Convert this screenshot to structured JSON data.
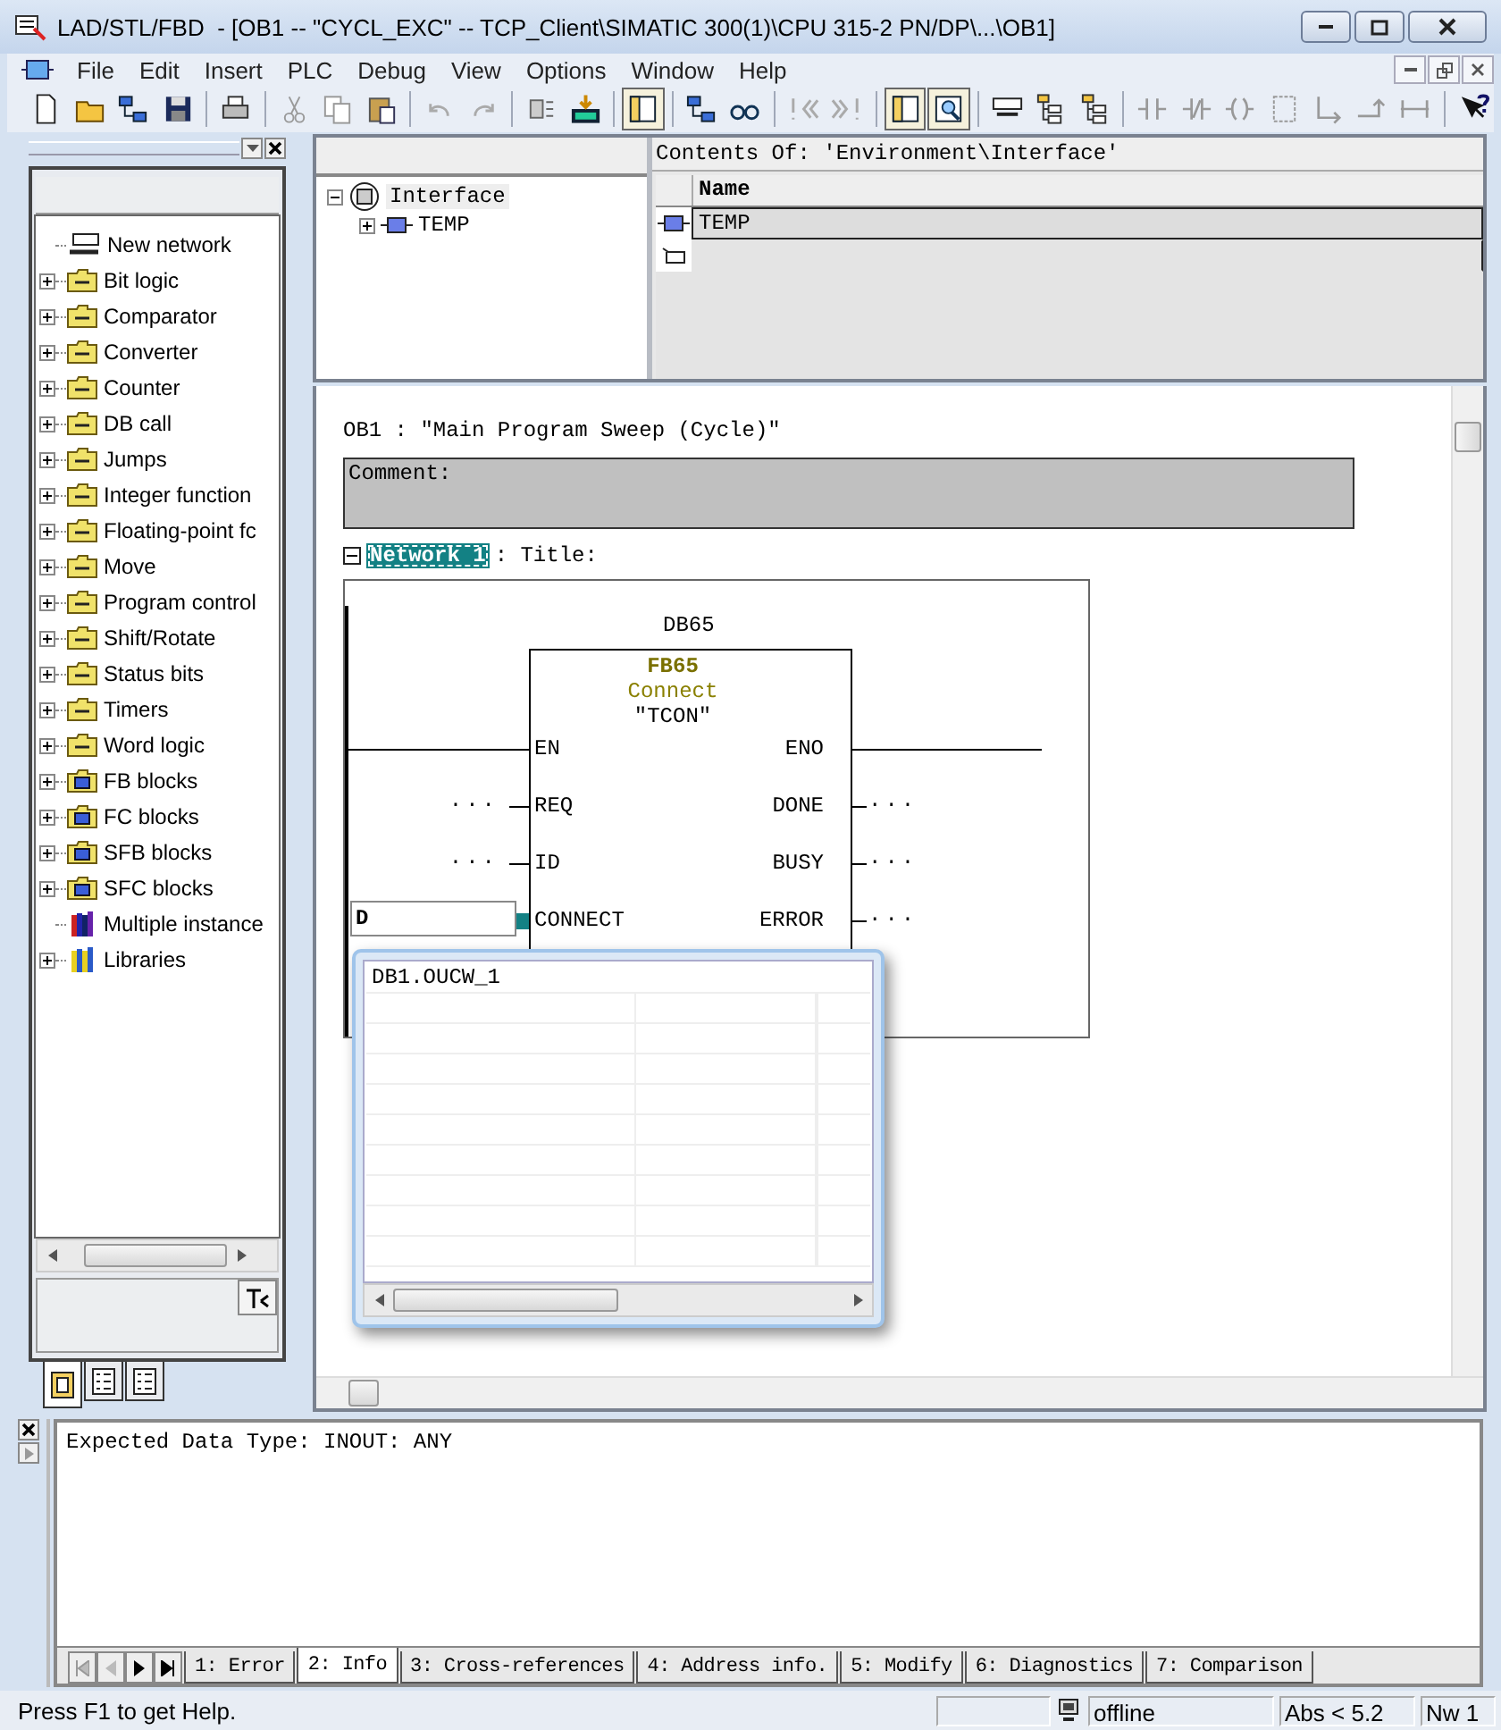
{
  "window": {
    "title": "LAD/STL/FBD  - [OB1 -- \"CYCL_EXC\" -- TCP_Client\\SIMATIC 300(1)\\CPU 315-2 PN/DP\\...\\OB1]"
  },
  "menu": [
    "File",
    "Edit",
    "Insert",
    "PLC",
    "Debug",
    "View",
    "Options",
    "Window",
    "Help"
  ],
  "catalog": {
    "items": [
      {
        "label": "New network",
        "kind": "network",
        "expandable": false
      },
      {
        "label": "Bit logic",
        "kind": "folder",
        "expandable": true
      },
      {
        "label": "Comparator",
        "kind": "folder",
        "expandable": true
      },
      {
        "label": "Converter",
        "kind": "folder",
        "expandable": true
      },
      {
        "label": "Counter",
        "kind": "folder",
        "expandable": true
      },
      {
        "label": "DB call",
        "kind": "folder",
        "expandable": true
      },
      {
        "label": "Jumps",
        "kind": "folder",
        "expandable": true
      },
      {
        "label": "Integer function",
        "kind": "folder",
        "expandable": true
      },
      {
        "label": "Floating-point fc",
        "kind": "folder",
        "expandable": true
      },
      {
        "label": "Move",
        "kind": "folder",
        "expandable": true
      },
      {
        "label": "Program control",
        "kind": "folder",
        "expandable": true
      },
      {
        "label": "Shift/Rotate",
        "kind": "folder",
        "expandable": true
      },
      {
        "label": "Status bits",
        "kind": "folder",
        "expandable": true
      },
      {
        "label": "Timers",
        "kind": "folder",
        "expandable": true
      },
      {
        "label": "Word logic",
        "kind": "folder",
        "expandable": true
      },
      {
        "label": "FB blocks",
        "kind": "block",
        "expandable": true
      },
      {
        "label": "FC blocks",
        "kind": "block",
        "expandable": true
      },
      {
        "label": "SFB blocks",
        "kind": "block",
        "expandable": true
      },
      {
        "label": "SFC blocks",
        "kind": "block",
        "expandable": true
      },
      {
        "label": "Multiple instance",
        "kind": "books",
        "expandable": false
      },
      {
        "label": "Libraries",
        "kind": "library",
        "expandable": true
      }
    ]
  },
  "interface": {
    "tree": [
      {
        "label": "Interface",
        "expanded": true,
        "children": [
          {
            "label": "TEMP",
            "expanded": false
          }
        ]
      }
    ],
    "contents_title": "Contents Of: 'Environment\\Interface'",
    "column": "Name",
    "rows": [
      {
        "name": "TEMP",
        "selected": true
      }
    ]
  },
  "editor": {
    "block_title": "OB1 :  ″Main Program Sweep (Cycle)″",
    "comment_label": "Comment:",
    "network": {
      "label": "Network 1",
      "title": ": Title:",
      "expanded": true
    },
    "block": {
      "instance": "DB65",
      "number": "FB65",
      "name": "Connect",
      "symbol": "″TCON″",
      "inputs": [
        {
          "pin": "EN",
          "kind": "wire"
        },
        {
          "pin": "REQ",
          "kind": "operand",
          "operand": "..."
        },
        {
          "pin": "ID",
          "kind": "operand",
          "operand": "..."
        },
        {
          "pin": "CONNECT",
          "kind": "field",
          "operand": "D"
        }
      ],
      "outputs": [
        {
          "pin": "ENO",
          "kind": "wire"
        },
        {
          "pin": "DONE",
          "kind": "operand",
          "operand": "..."
        },
        {
          "pin": "BUSY",
          "kind": "operand",
          "operand": "..."
        },
        {
          "pin": "ERROR",
          "kind": "operand",
          "operand": "..."
        }
      ]
    },
    "suggestions": [
      "DB1.OUCW_1"
    ]
  },
  "output": {
    "message": "Expected Data Type: INOUT: ANY",
    "tabs": [
      {
        "label": "1: Error",
        "selected": false
      },
      {
        "label": "2: Info",
        "selected": true
      },
      {
        "label": "3: Cross-references",
        "selected": false
      },
      {
        "label": "4: Address info.",
        "selected": false
      },
      {
        "label": "5: Modify",
        "selected": false
      },
      {
        "label": "6: Diagnostics",
        "selected": false
      },
      {
        "label": "7: Comparison",
        "selected": false
      }
    ]
  },
  "status_bar": {
    "help": "Press F1 to get Help.",
    "mode": "offline",
    "abs": "Abs < 5.2",
    "network": "Nw 1"
  }
}
